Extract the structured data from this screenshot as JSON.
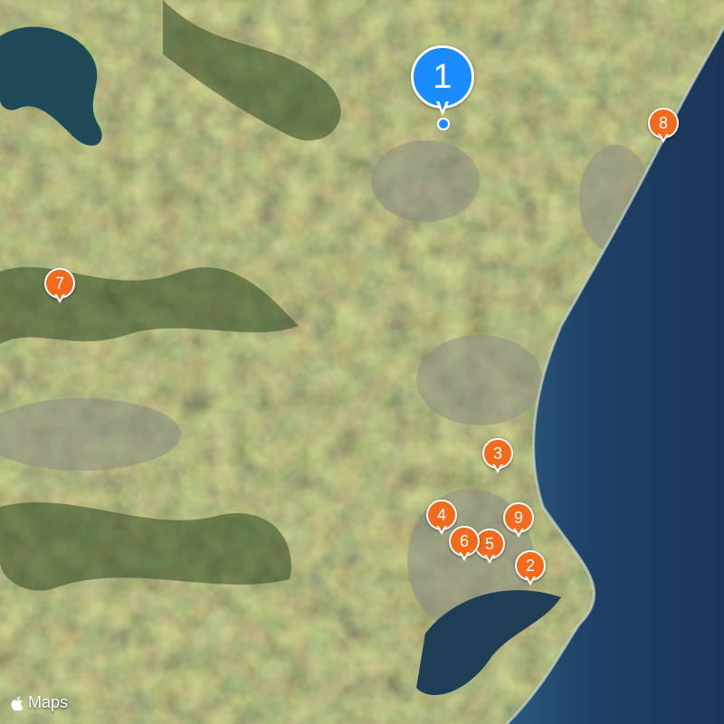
{
  "map": {
    "attribution": "Maps",
    "colors": {
      "ocean": "#1d3a5c",
      "land": "#5e6a3c",
      "main_pin": "#1a8cff",
      "pin": "#f26a1b"
    }
  },
  "main_pin": {
    "label": "1",
    "icon": "map-pin-icon"
  },
  "pins": [
    {
      "label": "2"
    },
    {
      "label": "3"
    },
    {
      "label": "4"
    },
    {
      "label": "5"
    },
    {
      "label": "6"
    },
    {
      "label": "7"
    },
    {
      "label": "8"
    },
    {
      "label": "9"
    }
  ]
}
